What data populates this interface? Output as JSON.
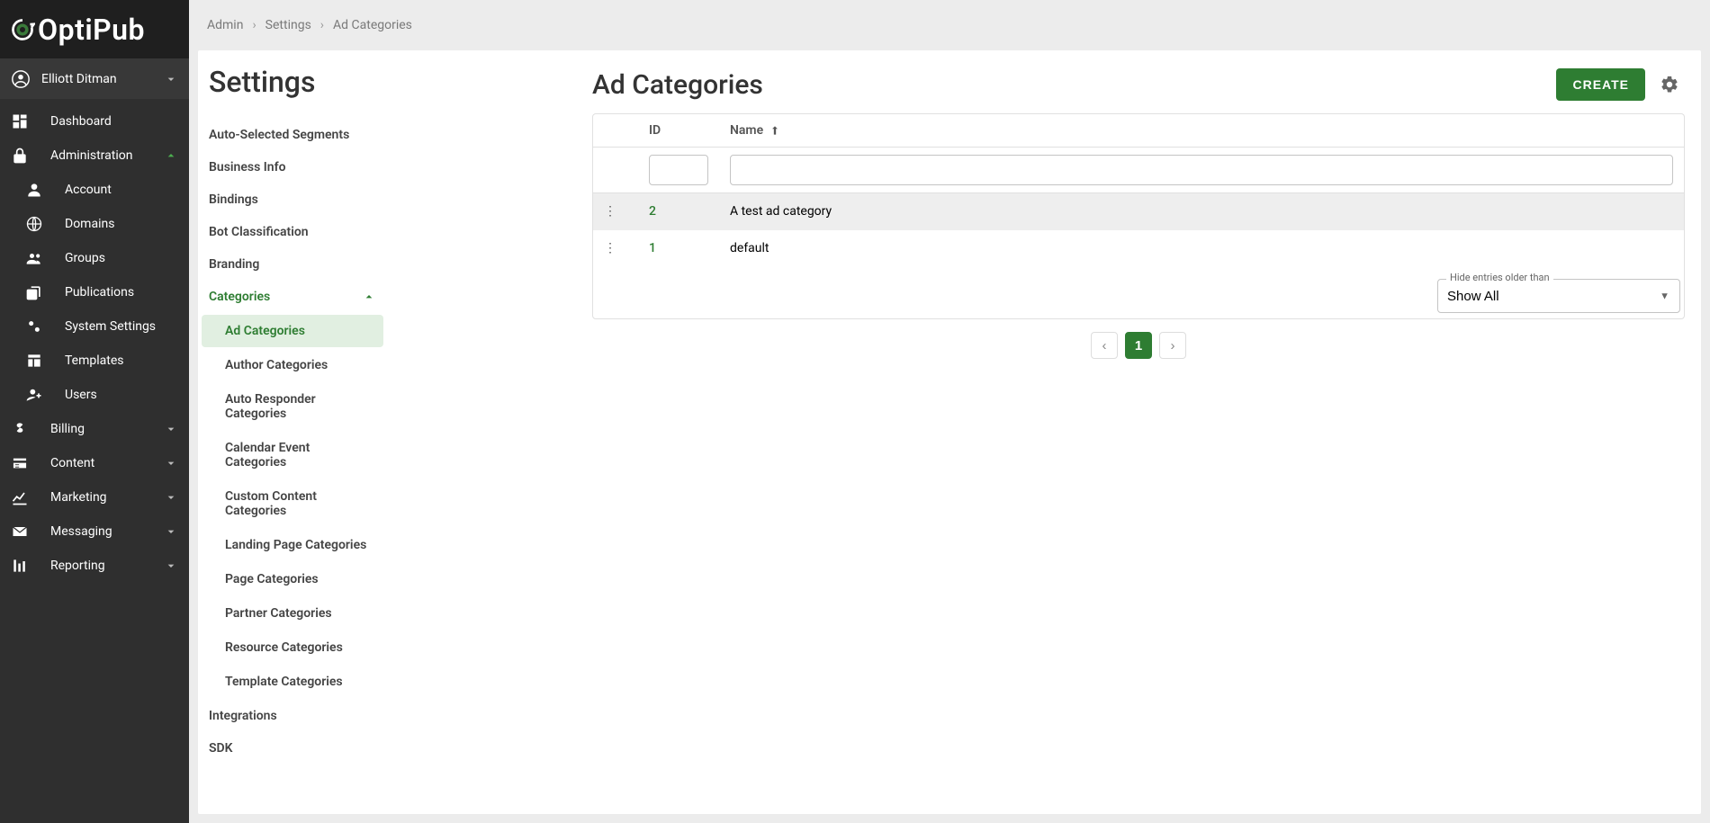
{
  "brand": "OptiPub",
  "user": {
    "name": "Elliott Ditman"
  },
  "breadcrumbs": [
    "Admin",
    "Settings",
    "Ad Categories"
  ],
  "sidebar": {
    "items": [
      {
        "label": "Dashboard",
        "icon": "dashboard",
        "kind": "link"
      },
      {
        "label": "Administration",
        "icon": "lock",
        "kind": "expand",
        "open": true,
        "children": [
          {
            "label": "Account",
            "icon": "person"
          },
          {
            "label": "Domains",
            "icon": "globe"
          },
          {
            "label": "Groups",
            "icon": "people"
          },
          {
            "label": "Publications",
            "icon": "copy"
          },
          {
            "label": "System Settings",
            "icon": "cogs"
          },
          {
            "label": "Templates",
            "icon": "template"
          },
          {
            "label": "Users",
            "icon": "user-plus"
          }
        ]
      },
      {
        "label": "Billing",
        "icon": "dollar",
        "kind": "expand",
        "open": false
      },
      {
        "label": "Content",
        "icon": "web",
        "kind": "expand",
        "open": false
      },
      {
        "label": "Marketing",
        "icon": "trend",
        "kind": "expand",
        "open": false
      },
      {
        "label": "Messaging",
        "icon": "mail",
        "kind": "expand",
        "open": false
      },
      {
        "label": "Reporting",
        "icon": "bar",
        "kind": "expand",
        "open": false
      }
    ]
  },
  "page": {
    "title": "Settings"
  },
  "settings_nav": {
    "items": [
      {
        "label": "Auto-Selected Segments"
      },
      {
        "label": "Business Info"
      },
      {
        "label": "Bindings"
      },
      {
        "label": "Bot Classification"
      },
      {
        "label": "Branding"
      },
      {
        "label": "Categories",
        "expandable": true,
        "open": true,
        "active": true,
        "children": [
          {
            "label": "Ad Categories",
            "active": true
          },
          {
            "label": "Author Categories"
          },
          {
            "label": "Auto Responder Categories"
          },
          {
            "label": "Calendar Event Categories"
          },
          {
            "label": "Custom Content Categories"
          },
          {
            "label": "Landing Page Categories"
          },
          {
            "label": "Page Categories"
          },
          {
            "label": "Partner Categories"
          },
          {
            "label": "Resource Categories"
          },
          {
            "label": "Template Categories"
          }
        ]
      },
      {
        "label": "Integrations"
      },
      {
        "label": "SDK"
      }
    ]
  },
  "panel": {
    "title": "Ad Categories",
    "create_label": "CREATE",
    "columns": {
      "id": "ID",
      "name": "Name"
    },
    "sort_column": "name",
    "sort_dir": "asc",
    "filters": {
      "id": "",
      "name": ""
    },
    "rows": [
      {
        "id": "2",
        "name": "A test ad category",
        "highlight": true
      },
      {
        "id": "1",
        "name": "default",
        "highlight": false
      }
    ],
    "hide_older": {
      "legend": "Hide entries older than",
      "value": "Show All"
    },
    "pager": {
      "current": "1"
    }
  }
}
